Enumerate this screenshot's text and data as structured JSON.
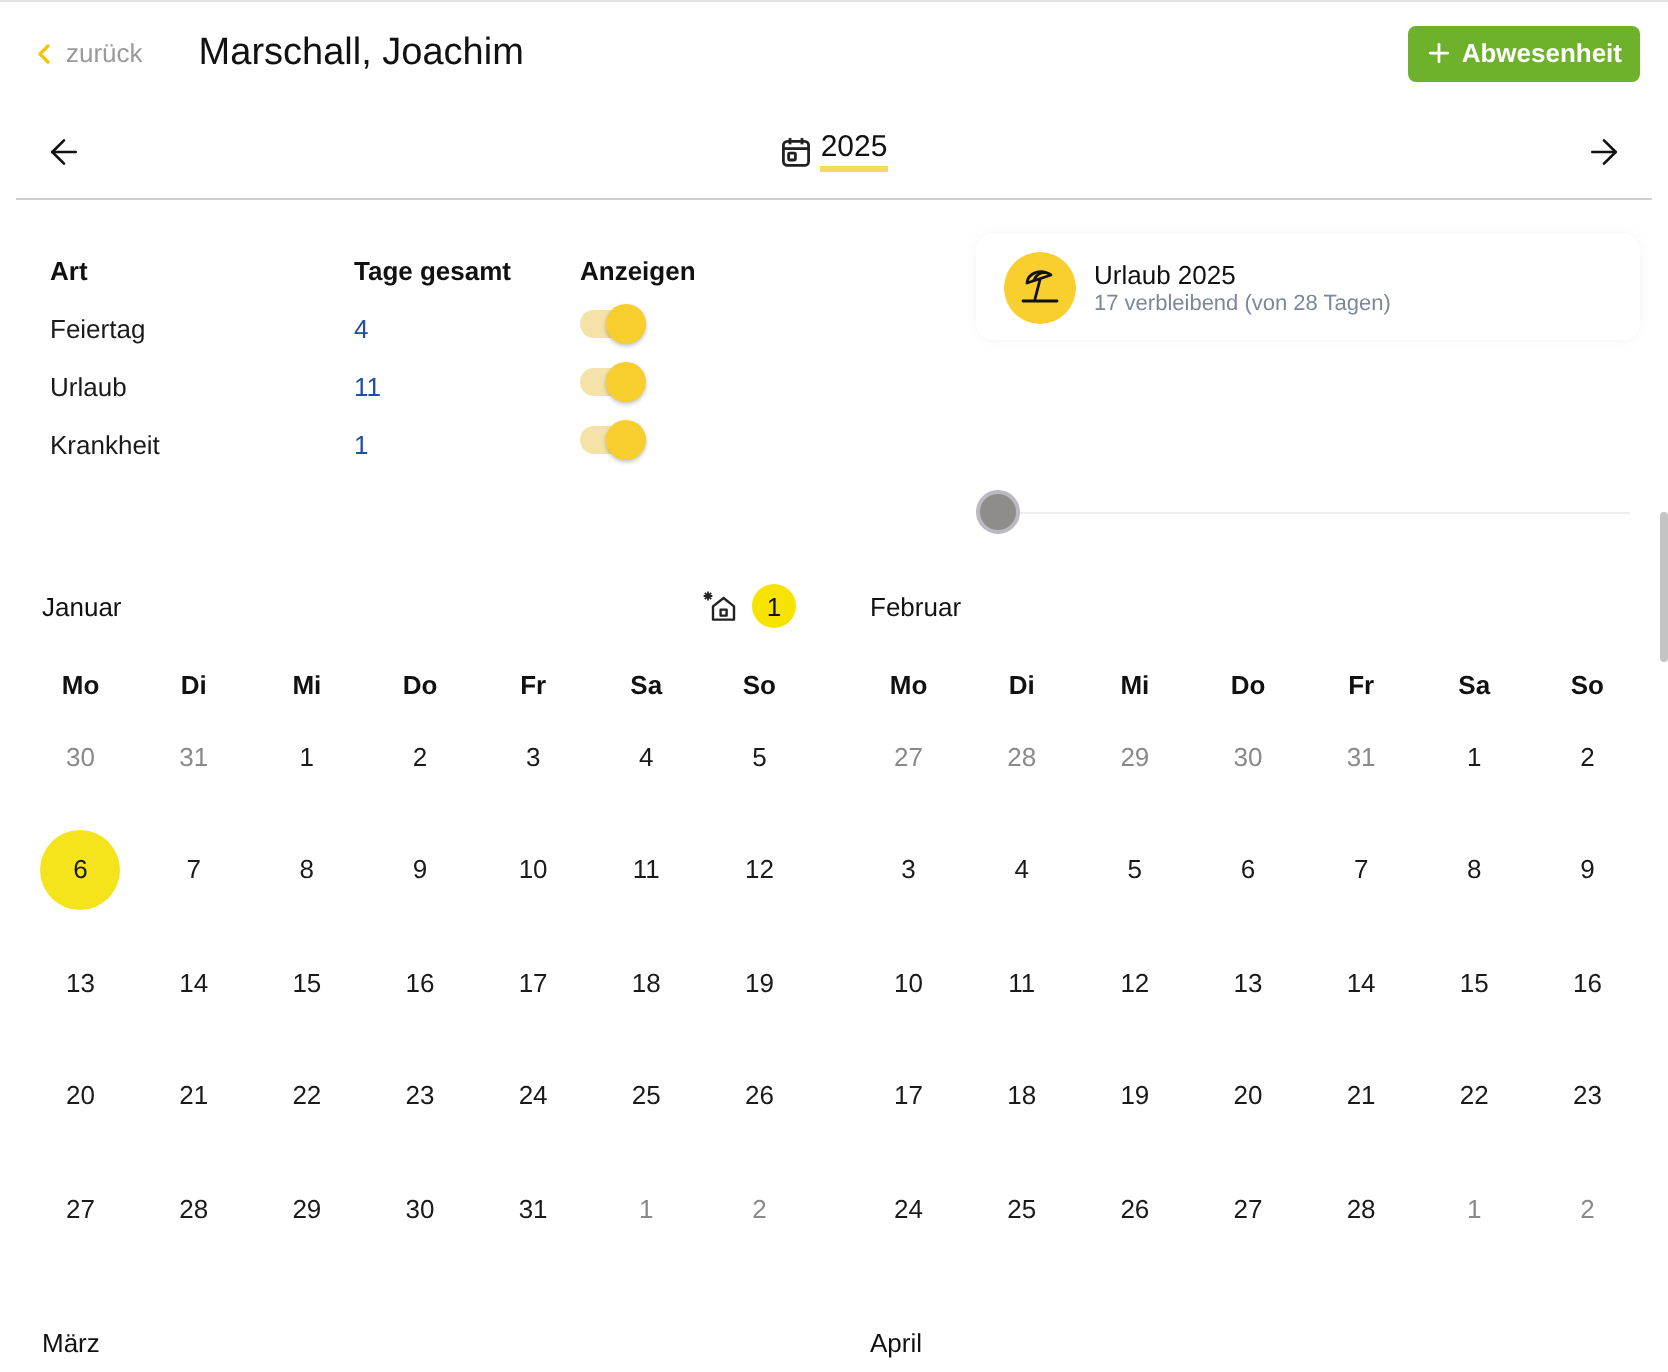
{
  "header": {
    "back_label": "zurück",
    "title": "Marschall, Joachim",
    "add_button": "Abwesenheit"
  },
  "year_nav": {
    "year": "2025"
  },
  "summary": {
    "columns": [
      "Art",
      "Tage gesamt",
      "Anzeigen"
    ],
    "rows": [
      {
        "type": "Feiertag",
        "days": "4",
        "shown": true
      },
      {
        "type": "Urlaub",
        "days": "11",
        "shown": true
      },
      {
        "type": "Krankheit",
        "days": "1",
        "shown": true
      }
    ]
  },
  "vacation_card": {
    "title": "Urlaub 2025",
    "subtitle": "17 verbleibend (von 28 Tagen)"
  },
  "slider": {
    "level": 0
  },
  "months": [
    {
      "name": "Januar",
      "holiday_count": "1",
      "weekdays": [
        "Mo",
        "Di",
        "Mi",
        "Do",
        "Fr",
        "Sa",
        "So"
      ],
      "weeks": [
        [
          {
            "day": "30",
            "outside": true,
            "holiday": false
          },
          {
            "day": "31",
            "outside": true,
            "holiday": false
          },
          {
            "day": "1",
            "outside": false,
            "holiday": false
          },
          {
            "day": "2",
            "outside": false,
            "holiday": false
          },
          {
            "day": "3",
            "outside": false,
            "holiday": false
          },
          {
            "day": "4",
            "outside": false,
            "holiday": false
          },
          {
            "day": "5",
            "outside": false,
            "holiday": false
          }
        ],
        [
          {
            "day": "6",
            "outside": false,
            "holiday": true
          },
          {
            "day": "7",
            "outside": false,
            "holiday": false
          },
          {
            "day": "8",
            "outside": false,
            "holiday": false
          },
          {
            "day": "9",
            "outside": false,
            "holiday": false
          },
          {
            "day": "10",
            "outside": false,
            "holiday": false
          },
          {
            "day": "11",
            "outside": false,
            "holiday": false
          },
          {
            "day": "12",
            "outside": false,
            "holiday": false
          }
        ],
        [
          {
            "day": "13",
            "outside": false,
            "holiday": false
          },
          {
            "day": "14",
            "outside": false,
            "holiday": false
          },
          {
            "day": "15",
            "outside": false,
            "holiday": false
          },
          {
            "day": "16",
            "outside": false,
            "holiday": false
          },
          {
            "day": "17",
            "outside": false,
            "holiday": false
          },
          {
            "day": "18",
            "outside": false,
            "holiday": false
          },
          {
            "day": "19",
            "outside": false,
            "holiday": false
          }
        ],
        [
          {
            "day": "20",
            "outside": false,
            "holiday": false
          },
          {
            "day": "21",
            "outside": false,
            "holiday": false
          },
          {
            "day": "22",
            "outside": false,
            "holiday": false
          },
          {
            "day": "23",
            "outside": false,
            "holiday": false
          },
          {
            "day": "24",
            "outside": false,
            "holiday": false
          },
          {
            "day": "25",
            "outside": false,
            "holiday": false
          },
          {
            "day": "26",
            "outside": false,
            "holiday": false
          }
        ],
        [
          {
            "day": "27",
            "outside": false,
            "holiday": false
          },
          {
            "day": "28",
            "outside": false,
            "holiday": false
          },
          {
            "day": "29",
            "outside": false,
            "holiday": false
          },
          {
            "day": "30",
            "outside": false,
            "holiday": false
          },
          {
            "day": "31",
            "outside": false,
            "holiday": false
          },
          {
            "day": "1",
            "outside": true,
            "holiday": false
          },
          {
            "day": "2",
            "outside": true,
            "holiday": false
          }
        ]
      ]
    },
    {
      "name": "Februar",
      "weekdays": [
        "Mo",
        "Di",
        "Mi",
        "Do",
        "Fr",
        "Sa",
        "So"
      ],
      "weeks": [
        [
          {
            "day": "27",
            "outside": true,
            "holiday": false
          },
          {
            "day": "28",
            "outside": true,
            "holiday": false
          },
          {
            "day": "29",
            "outside": true,
            "holiday": false
          },
          {
            "day": "30",
            "outside": true,
            "holiday": false
          },
          {
            "day": "31",
            "outside": true,
            "holiday": false
          },
          {
            "day": "1",
            "outside": false,
            "holiday": false
          },
          {
            "day": "2",
            "outside": false,
            "holiday": false
          }
        ],
        [
          {
            "day": "3",
            "outside": false,
            "holiday": false
          },
          {
            "day": "4",
            "outside": false,
            "holiday": false
          },
          {
            "day": "5",
            "outside": false,
            "holiday": false
          },
          {
            "day": "6",
            "outside": false,
            "holiday": false
          },
          {
            "day": "7",
            "outside": false,
            "holiday": false
          },
          {
            "day": "8",
            "outside": false,
            "holiday": false
          },
          {
            "day": "9",
            "outside": false,
            "holiday": false
          }
        ],
        [
          {
            "day": "10",
            "outside": false,
            "holiday": false
          },
          {
            "day": "11",
            "outside": false,
            "holiday": false
          },
          {
            "day": "12",
            "outside": false,
            "holiday": false
          },
          {
            "day": "13",
            "outside": false,
            "holiday": false
          },
          {
            "day": "14",
            "outside": false,
            "holiday": false
          },
          {
            "day": "15",
            "outside": false,
            "holiday": false
          },
          {
            "day": "16",
            "outside": false,
            "holiday": false
          }
        ],
        [
          {
            "day": "17",
            "outside": false,
            "holiday": false
          },
          {
            "day": "18",
            "outside": false,
            "holiday": false
          },
          {
            "day": "19",
            "outside": false,
            "holiday": false
          },
          {
            "day": "20",
            "outside": false,
            "holiday": false
          },
          {
            "day": "21",
            "outside": false,
            "holiday": false
          },
          {
            "day": "22",
            "outside": false,
            "holiday": false
          },
          {
            "day": "23",
            "outside": false,
            "holiday": false
          }
        ],
        [
          {
            "day": "24",
            "outside": false,
            "holiday": false
          },
          {
            "day": "25",
            "outside": false,
            "holiday": false
          },
          {
            "day": "26",
            "outside": false,
            "holiday": false
          },
          {
            "day": "27",
            "outside": false,
            "holiday": false
          },
          {
            "day": "28",
            "outside": false,
            "holiday": false
          },
          {
            "day": "1",
            "outside": true,
            "holiday": false
          },
          {
            "day": "2",
            "outside": true,
            "holiday": false
          }
        ]
      ]
    },
    {
      "name": "März"
    },
    {
      "name": "April"
    }
  ]
}
